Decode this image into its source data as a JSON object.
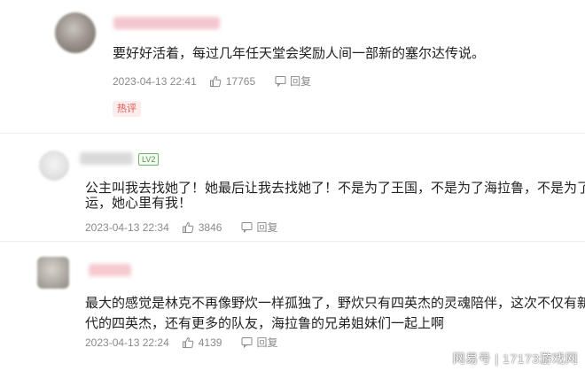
{
  "comments": [
    {
      "text": "要好好活着，每过几年任天堂会奖励人间一部新的塞尔达传说。",
      "date": "2023-04-13 22:41",
      "likes": "17765",
      "reply_label": "回复",
      "tag": "热评",
      "name_color": "#f3c6cf"
    },
    {
      "badge": "LV2",
      "lines": [
        "公主叫我去找她了！她最后让我去找她了！不是为了王国，不是为了海拉鲁，不是为了命",
        "运，她心里有我！"
      ],
      "date": "2023-04-13 22:34",
      "likes": "3846",
      "reply_label": "回复",
      "name_color": "#d9d9d9"
    },
    {
      "lines": [
        "最大的感觉是林克不再像野炊一样孤独了，野炊只有四英杰的灵魂陪伴，这次不仅有新生",
        "代的四英杰，还有更多的队友，海拉鲁的兄弟姐妹们一起上啊"
      ],
      "date": "2023-04-13 22:24",
      "likes": "4139",
      "reply_label": "回复",
      "name_color": "#f6c9cf"
    }
  ],
  "watermark": "网易号 | 17173游戏网",
  "colors": {
    "hot_tag": "#e3534e",
    "meta": "#8a8a8a",
    "badge": "#4f9a47"
  }
}
